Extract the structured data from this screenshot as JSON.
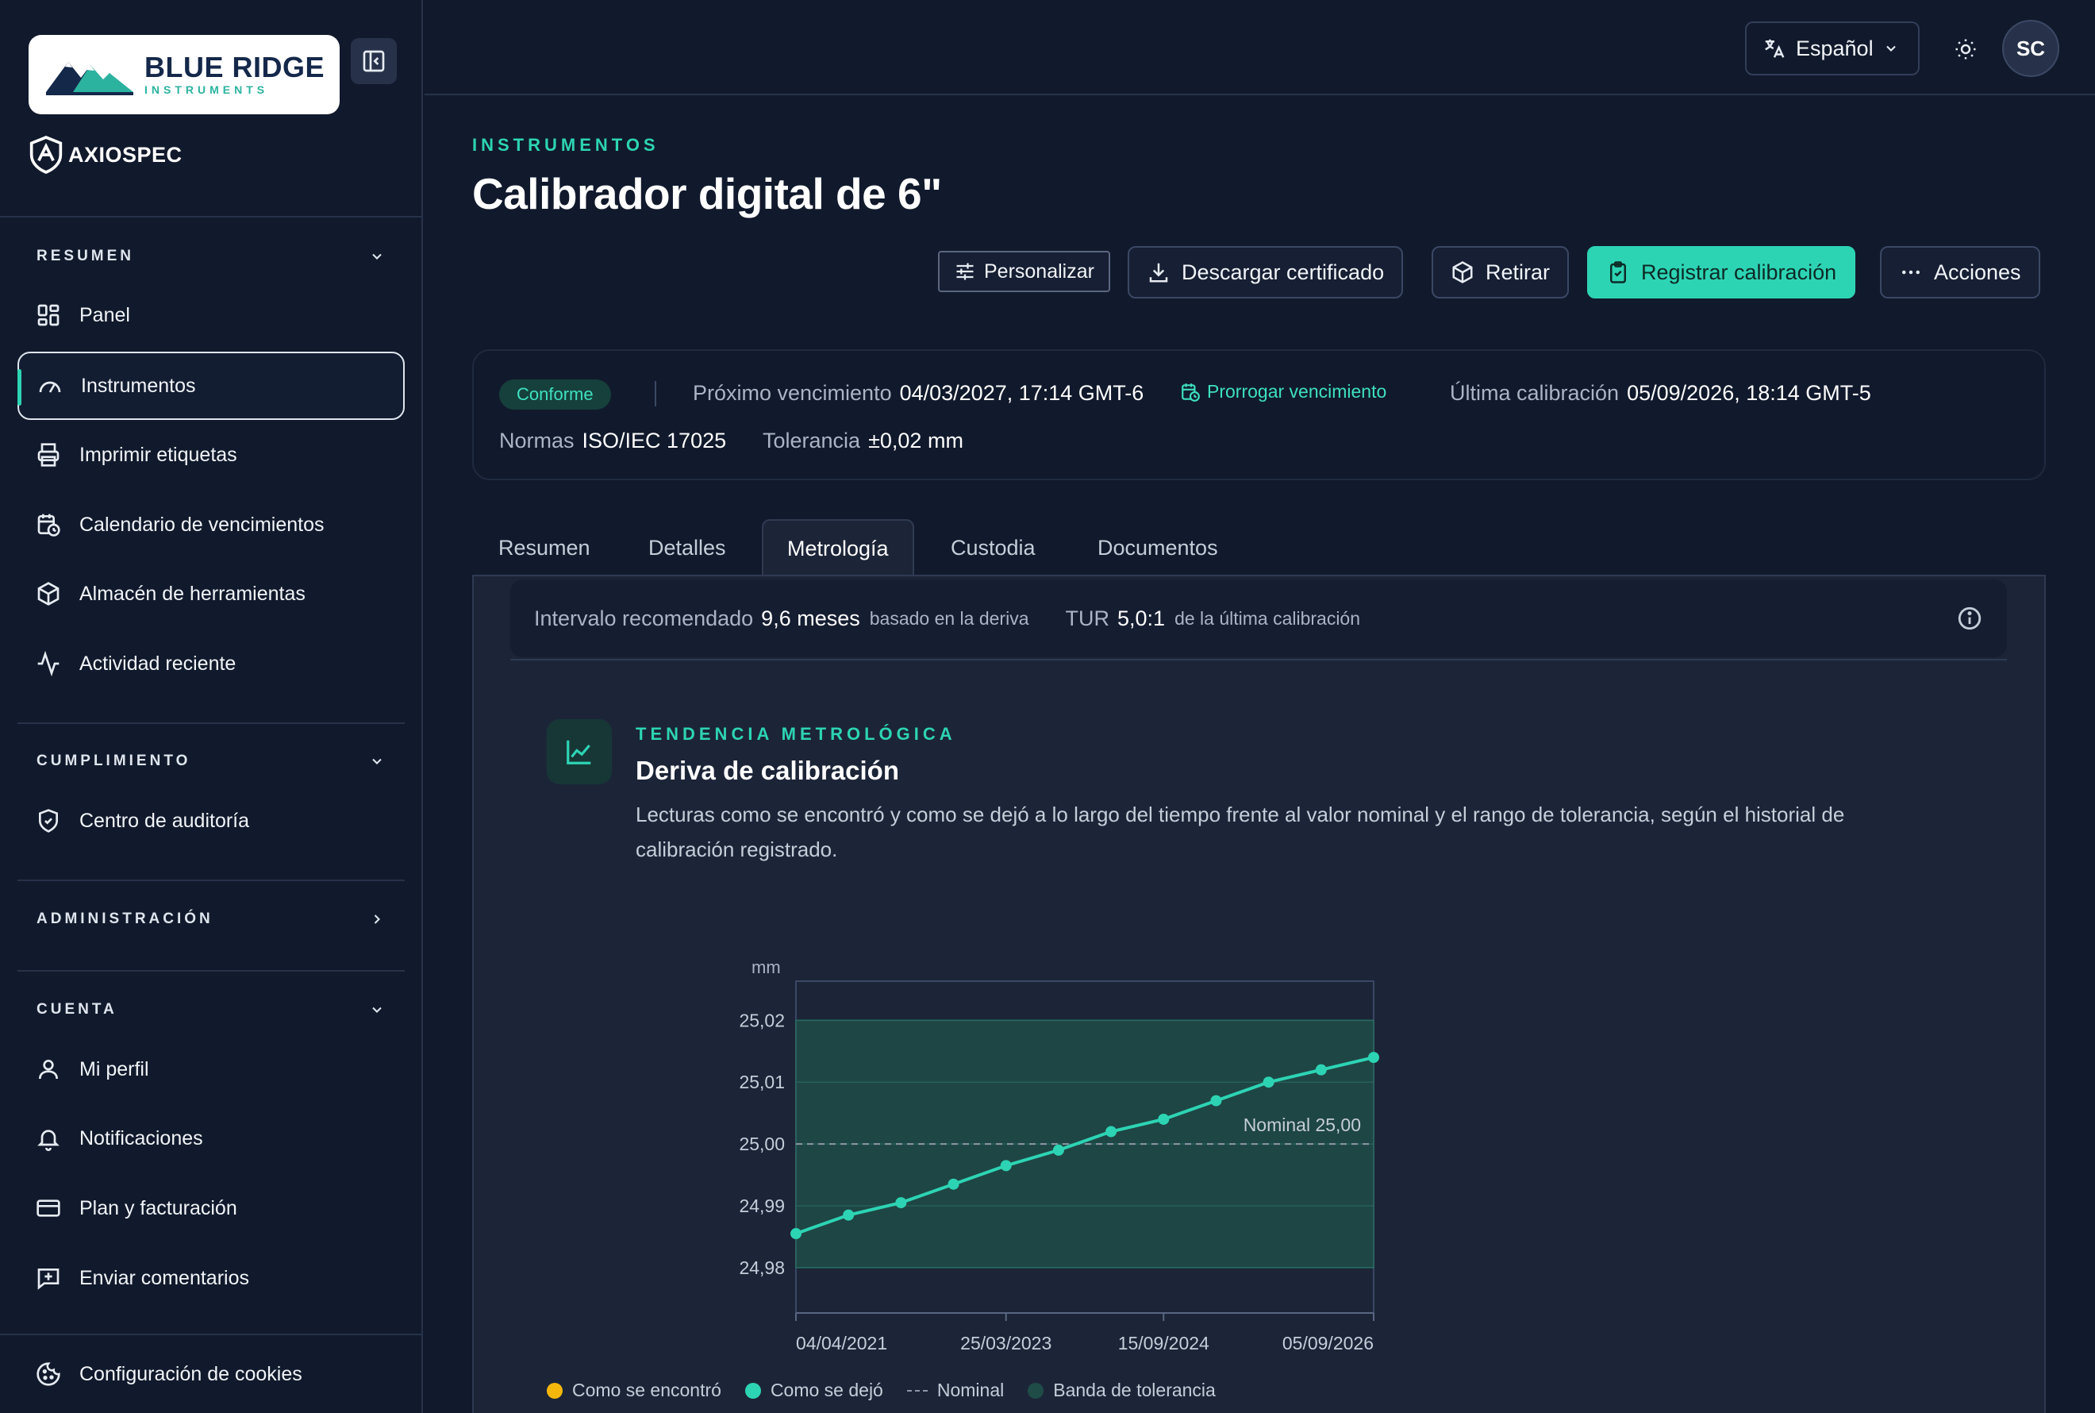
{
  "brand": {
    "name": "BLUE RIDGE",
    "sub": "INSTRUMENTS",
    "platform": "AXIOSPEC"
  },
  "sidebar": {
    "sections": [
      {
        "title": "RESUMEN",
        "items": [
          "Panel",
          "Instrumentos",
          "Imprimir etiquetas",
          "Calendario de vencimientos",
          "Almacén de herramientas",
          "Actividad reciente"
        ]
      },
      {
        "title": "CUMPLIMIENTO",
        "items": [
          "Centro de auditoría"
        ]
      },
      {
        "title": "ADMINISTRACIÓN",
        "items": []
      },
      {
        "title": "CUENTA",
        "items": [
          "Mi perfil",
          "Notificaciones",
          "Plan y facturación",
          "Enviar comentarios"
        ]
      }
    ],
    "footer_item": "Configuración de cookies",
    "active_item": "Instrumentos"
  },
  "topbar": {
    "language": "Español",
    "avatar_initials": "SC"
  },
  "header": {
    "eyebrow": "INSTRUMENTOS",
    "title": "Calibrador digital de 6\"",
    "actions": {
      "customize": "Personalizar",
      "download": "Descargar certificado",
      "retire": "Retirar",
      "register": "Registrar calibración",
      "more": "Acciones"
    }
  },
  "info": {
    "status": "Conforme",
    "next_due_label": "Próximo vencimiento",
    "next_due_value": "04/03/2027, 17:14 GMT-6",
    "extend_link": "Prorrogar vencimiento",
    "last_cal_label": "Última calibración",
    "last_cal_value": "05/09/2026, 18:14 GMT-5",
    "standards_label": "Normas",
    "standards_value": "ISO/IEC 17025",
    "tolerance_label": "Tolerancia",
    "tolerance_value": "±0,02 mm"
  },
  "tabs": [
    "Resumen",
    "Detalles",
    "Metrología",
    "Custodia",
    "Documentos"
  ],
  "active_tab": "Metrología",
  "recommendation": {
    "interval_label": "Intervalo recomendado",
    "interval_value": "9,6 meses",
    "interval_suffix": "basado en la deriva",
    "tur_label": "TUR",
    "tur_value": "5,0:1",
    "tur_suffix": "de la última calibración"
  },
  "trend": {
    "eyebrow": "TENDENCIA METROLÓGICA",
    "title": "Deriva de calibración",
    "description": "Lecturas como se encontró y como se dejó a lo largo del tiempo frente al valor nominal y el rango de tolerancia, según el historial de calibración registrado."
  },
  "chart_data": {
    "type": "line",
    "ylabel": "mm",
    "ylim": [
      24.976,
      25.023
    ],
    "y_ticks": [
      "25,02",
      "25,01",
      "25,00",
      "24,99",
      "24,98"
    ],
    "y_tick_values": [
      25.02,
      25.01,
      25.0,
      24.99,
      24.98
    ],
    "x_tick_labels": [
      "04/04/2021",
      "25/03/2023",
      "15/09/2024",
      "05/09/2026"
    ],
    "x_tick_index": [
      0,
      4,
      7,
      11
    ],
    "nominal": 25.0,
    "nominal_label": "Nominal 25,00",
    "tolerance_band": [
      24.98,
      25.02
    ],
    "grid": true,
    "series": [
      {
        "name": "Como se dejó",
        "color": "#2dd4b4",
        "values": [
          24.9855,
          24.9885,
          24.9905,
          24.9935,
          24.9965,
          24.999,
          25.002,
          25.004,
          25.007,
          25.01,
          25.012,
          25.014
        ]
      }
    ],
    "legend": [
      {
        "label": "Como se encontró",
        "color": "#f5b70b",
        "kind": "dot"
      },
      {
        "label": "Como se dejó",
        "color": "#2dd4b4",
        "kind": "dot"
      },
      {
        "label": "Nominal",
        "color": "#8d97a8",
        "kind": "dash"
      },
      {
        "label": "Banda de tolerancia",
        "color": "#1f4c47",
        "kind": "dot"
      }
    ],
    "legend_position": "bottom-left"
  }
}
